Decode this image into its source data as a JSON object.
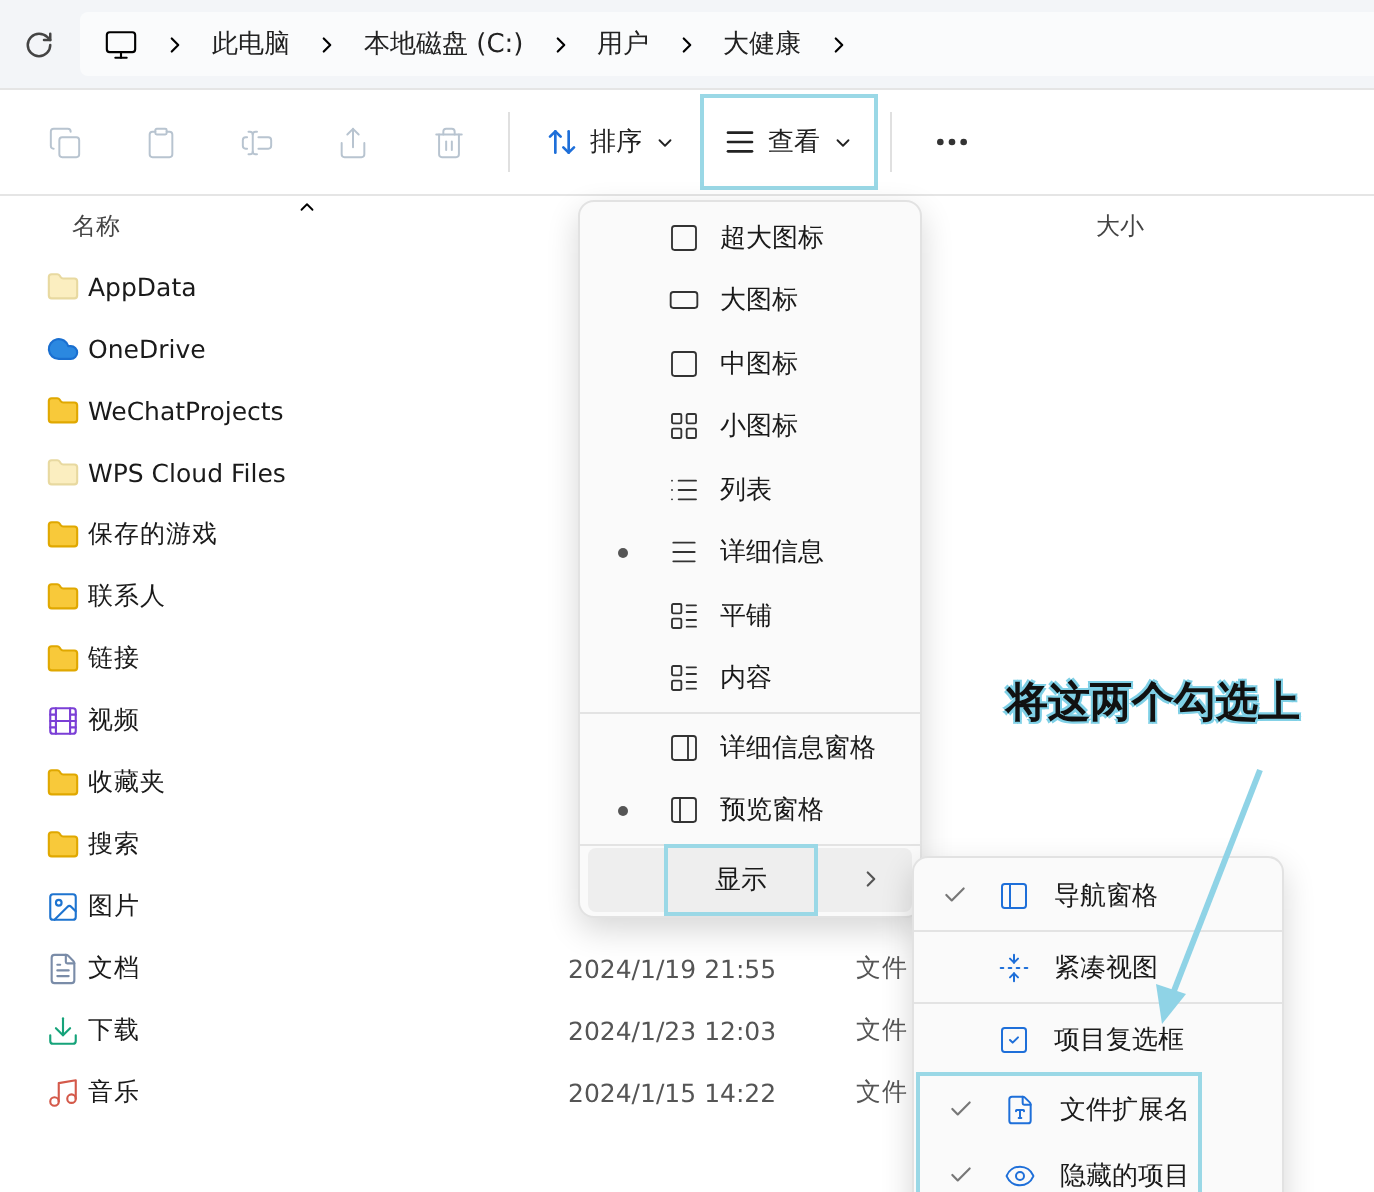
{
  "breadcrumb": [
    "此电脑",
    "本地磁盘 (C:)",
    "用户",
    "大健康"
  ],
  "toolbar": {
    "sort": {
      "label": "排序"
    },
    "view": {
      "label": "查看",
      "highlighted": true
    }
  },
  "columns": [
    "名称",
    "大小"
  ],
  "files": [
    {
      "name": "AppData",
      "kind": "folder-light"
    },
    {
      "name": "OneDrive",
      "kind": "cloud"
    },
    {
      "name": "WeChatProjects",
      "kind": "folder"
    },
    {
      "name": "WPS Cloud Files",
      "kind": "folder-light"
    },
    {
      "name": "保存的游戏",
      "kind": "folder"
    },
    {
      "name": "联系人",
      "kind": "folder"
    },
    {
      "name": "链接",
      "kind": "folder"
    },
    {
      "name": "视频",
      "kind": "video"
    },
    {
      "name": "收藏夹",
      "kind": "folder"
    },
    {
      "name": "搜索",
      "kind": "folder"
    },
    {
      "name": "图片",
      "kind": "image"
    },
    {
      "name": "文档",
      "kind": "doc",
      "date": "2024/1/19 21:55",
      "type": "文件"
    },
    {
      "name": "下载",
      "kind": "download",
      "date": "2024/1/23 12:03",
      "type": "文件"
    },
    {
      "name": "音乐",
      "kind": "music",
      "date": "2024/1/15 14:22",
      "type": "文件"
    }
  ],
  "view_menu": [
    {
      "label": "超大图标",
      "checked": false
    },
    {
      "label": "大图标",
      "checked": false
    },
    {
      "label": "中图标",
      "checked": false
    },
    {
      "label": "小图标",
      "checked": false
    },
    {
      "label": "列表",
      "checked": false
    },
    {
      "label": "详细信息",
      "checked": true
    },
    {
      "label": "平铺",
      "checked": false
    },
    {
      "label": "内容",
      "checked": false
    },
    {
      "label": "详细信息窗格",
      "checked": false
    },
    {
      "label": "预览窗格",
      "checked": true
    },
    {
      "label": "显示",
      "highlighted": true
    }
  ],
  "show_menu": [
    {
      "label": "导航窗格",
      "checked": true,
      "highlighted": false
    },
    {
      "label": "紧凑视图",
      "checked": false,
      "highlighted": false
    },
    {
      "label": "项目复选框",
      "checked": false,
      "highlighted": false
    },
    {
      "label": "文件扩展名",
      "checked": true,
      "highlighted": true
    },
    {
      "label": "隐藏的项目",
      "checked": true,
      "highlighted": true
    }
  ],
  "annotation": {
    "text": "将这两个勾选上"
  }
}
